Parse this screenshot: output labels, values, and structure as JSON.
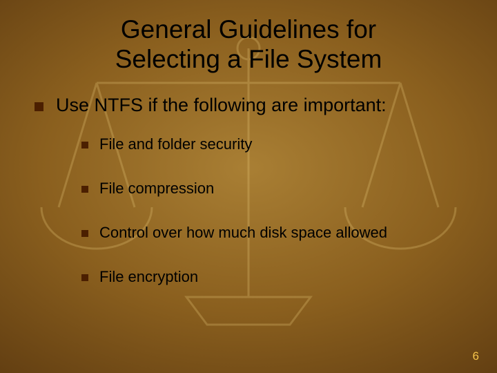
{
  "title_line1": "General Guidelines for",
  "title_line2": "Selecting a File System",
  "main_point": "Use NTFS if the following are important:",
  "sub_points": [
    "File and folder security",
    "File compression",
    "Control over how much disk space allowed",
    "File encryption"
  ],
  "page_number": "6"
}
